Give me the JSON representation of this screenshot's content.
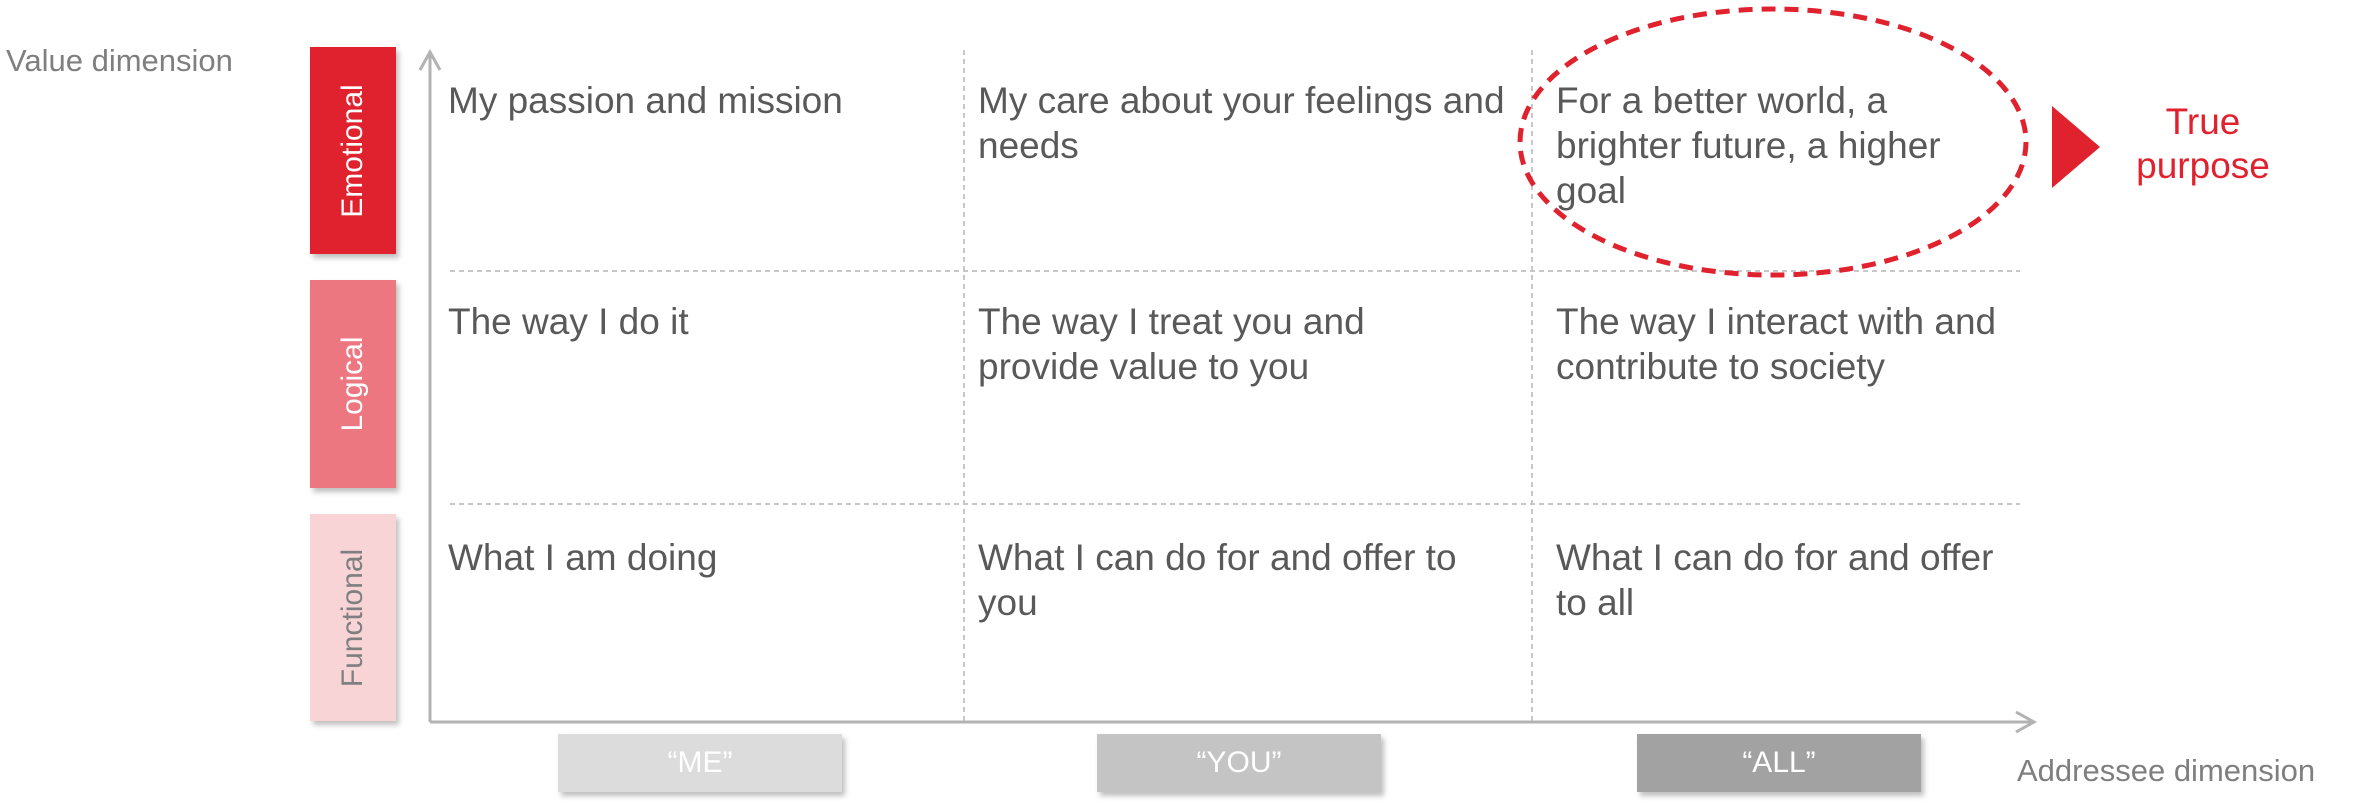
{
  "axes": {
    "value_title": "Value dimension",
    "addressee_title": "Addressee dimension"
  },
  "rows": [
    {
      "label": "Emotional",
      "color": "#e0222e"
    },
    {
      "label": "Logical",
      "color": "#ec7780"
    },
    {
      "label": "Functional",
      "color": "#f8d4d6"
    }
  ],
  "columns": [
    {
      "label": "“ME”",
      "color": "#dcdcdc"
    },
    {
      "label": "“YOU”",
      "color": "#c4c4c4"
    },
    {
      "label": "“ALL”",
      "color": "#a2a2a2"
    }
  ],
  "cells": {
    "emotional": [
      "My passion and mission",
      "My care about your feelings and needs",
      "For a better world, a brighter future, a higher goal"
    ],
    "logical": [
      "The way I do it",
      "The way I treat you and provide value to you",
      "The way I interact with and contribute to society"
    ],
    "functional": [
      "What I am doing",
      "What I can do for and offer to you",
      "What I can do for and offer to all"
    ]
  },
  "highlight": {
    "label": "True purpose",
    "color": "#e0222e"
  },
  "colors": {
    "axis": "#b3b3b3",
    "grid": "#c8c8c8",
    "text": "#595959"
  }
}
